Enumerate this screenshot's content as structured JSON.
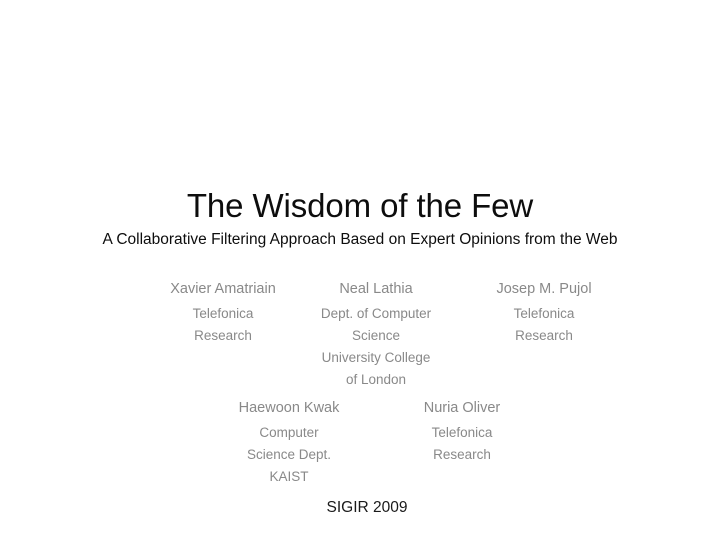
{
  "slide": {
    "background_color": "#ffffff",
    "title": "The Wisdom of the Few",
    "subtitle": "A Collaborative Filtering Approach Based on Expert Opinions from the Web",
    "title_color": "#0d0d0d",
    "author_color": "#898989",
    "footer_color": "#1a1a1a"
  },
  "authors": {
    "row1": [
      {
        "name": "Xavier Amatriain",
        "affiliation_lines": [
          "Telefonica",
          "Research"
        ]
      },
      {
        "name": "Neal Lathia",
        "affiliation_lines": [
          "Dept. of Computer",
          "Science",
          "University College",
          "of London"
        ]
      },
      {
        "name": "Josep M. Pujol",
        "affiliation_lines": [
          "Telefonica",
          "Research"
        ]
      }
    ],
    "row2": [
      {
        "name": "Haewoon Kwak",
        "affiliation_lines": [
          "Computer",
          "Science Dept.",
          "KAIST"
        ]
      },
      {
        "name": "Nuria Oliver",
        "affiliation_lines": [
          "Telefonica",
          "Research"
        ]
      }
    ]
  },
  "footer": {
    "text": "SIGIR 2009"
  }
}
